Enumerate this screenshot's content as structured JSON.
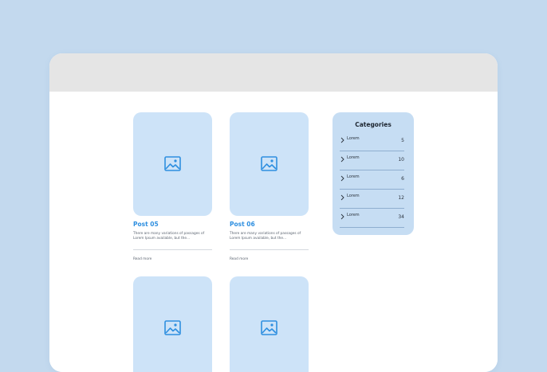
{
  "colors": {
    "background": "#c3d9ee",
    "window_bar": "#e5e5e5",
    "thumbnail": "#cde3f8",
    "accent": "#2e8fe0",
    "sidebar": "#c6ddf3"
  },
  "posts": [
    {
      "title": "Post 05",
      "excerpt": "There are many variations of passages of Lorem Ipsum available, but the...",
      "read_more": "Read more",
      "icon": "image-icon"
    },
    {
      "title": "Post 06",
      "excerpt": "There are many variations of passages of Lorem Ipsum available, but the...",
      "read_more": "Read more",
      "icon": "image-icon"
    },
    {
      "icon": "image-icon"
    },
    {
      "icon": "image-icon"
    }
  ],
  "categories": {
    "title": "Categories",
    "items": [
      {
        "label": "Lorem",
        "count": "5",
        "icon": "chevron-right-icon"
      },
      {
        "label": "Lorem",
        "count": "10",
        "icon": "chevron-right-icon"
      },
      {
        "label": "Lorem",
        "count": "6",
        "icon": "chevron-right-icon"
      },
      {
        "label": "Lorem",
        "count": "12",
        "icon": "chevron-right-icon"
      },
      {
        "label": "Lorem",
        "count": "34",
        "icon": "chevron-right-icon"
      }
    ]
  }
}
